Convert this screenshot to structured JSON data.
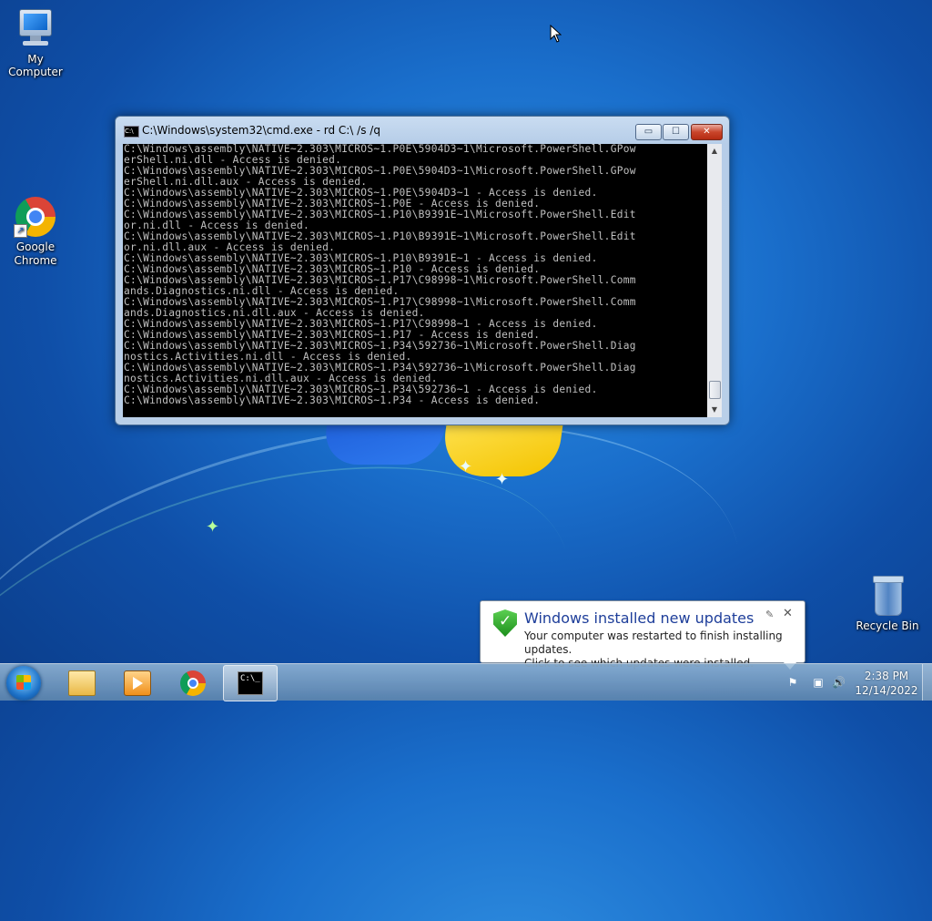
{
  "desktop": {
    "icons": [
      {
        "label": "My Computer",
        "icon": "computer-icon"
      },
      {
        "label": "Google\nChrome",
        "icon": "chrome-icon"
      },
      {
        "label": "Recycle Bin",
        "icon": "recycle-bin-icon"
      }
    ]
  },
  "cmd_window": {
    "title": "C:\\Windows\\system32\\cmd.exe - rd  C:\\ /s /q",
    "buttons": {
      "minimize": "▭",
      "maximize": "☐",
      "close": "✕"
    },
    "lines": [
      "C:\\Windows\\assembly\\NATIVE~2.303\\MICROS~1.P0E\\5904D3~1\\Microsoft.PowerShell.GPow",
      "erShell.ni.dll - Access is denied.",
      "C:\\Windows\\assembly\\NATIVE~2.303\\MICROS~1.P0E\\5904D3~1\\Microsoft.PowerShell.GPow",
      "erShell.ni.dll.aux - Access is denied.",
      "C:\\Windows\\assembly\\NATIVE~2.303\\MICROS~1.P0E\\5904D3~1 - Access is denied.",
      "C:\\Windows\\assembly\\NATIVE~2.303\\MICROS~1.P0E - Access is denied.",
      "C:\\Windows\\assembly\\NATIVE~2.303\\MICROS~1.P10\\B9391E~1\\Microsoft.PowerShell.Edit",
      "or.ni.dll - Access is denied.",
      "C:\\Windows\\assembly\\NATIVE~2.303\\MICROS~1.P10\\B9391E~1\\Microsoft.PowerShell.Edit",
      "or.ni.dll.aux - Access is denied.",
      "C:\\Windows\\assembly\\NATIVE~2.303\\MICROS~1.P10\\B9391E~1 - Access is denied.",
      "C:\\Windows\\assembly\\NATIVE~2.303\\MICROS~1.P10 - Access is denied.",
      "C:\\Windows\\assembly\\NATIVE~2.303\\MICROS~1.P17\\C98998~1\\Microsoft.PowerShell.Comm",
      "ands.Diagnostics.ni.dll - Access is denied.",
      "C:\\Windows\\assembly\\NATIVE~2.303\\MICROS~1.P17\\C98998~1\\Microsoft.PowerShell.Comm",
      "ands.Diagnostics.ni.dll.aux - Access is denied.",
      "C:\\Windows\\assembly\\NATIVE~2.303\\MICROS~1.P17\\C98998~1 - Access is denied.",
      "C:\\Windows\\assembly\\NATIVE~2.303\\MICROS~1.P17 - Access is denied.",
      "C:\\Windows\\assembly\\NATIVE~2.303\\MICROS~1.P34\\592736~1\\Microsoft.PowerShell.Diag",
      "nostics.Activities.ni.dll - Access is denied.",
      "C:\\Windows\\assembly\\NATIVE~2.303\\MICROS~1.P34\\592736~1\\Microsoft.PowerShell.Diag",
      "nostics.Activities.ni.dll.aux - Access is denied.",
      "C:\\Windows\\assembly\\NATIVE~2.303\\MICROS~1.P34\\592736~1 - Access is denied.",
      "C:\\Windows\\assembly\\NATIVE~2.303\\MICROS~1.P34 - Access is denied."
    ]
  },
  "notification": {
    "title": "Windows installed new updates",
    "body_line1": "Your computer was restarted to finish installing updates.",
    "body_line2": "Click to see which updates were installed.",
    "options_icon": "✎",
    "close_icon": "✕"
  },
  "taskbar": {
    "pinned": [
      {
        "name": "windows-explorer",
        "icon": "folder-icon"
      },
      {
        "name": "windows-media-player",
        "icon": "media-player-icon"
      },
      {
        "name": "google-chrome",
        "icon": "chrome-icon"
      },
      {
        "name": "command-prompt",
        "icon": "cmd-icon",
        "active": true,
        "glyph": "C:\\_"
      }
    ],
    "tray": {
      "flag": "⚑",
      "network": "▣",
      "volume": "🔊"
    },
    "clock": {
      "time": "2:38 PM",
      "date": "12/14/2022"
    }
  }
}
